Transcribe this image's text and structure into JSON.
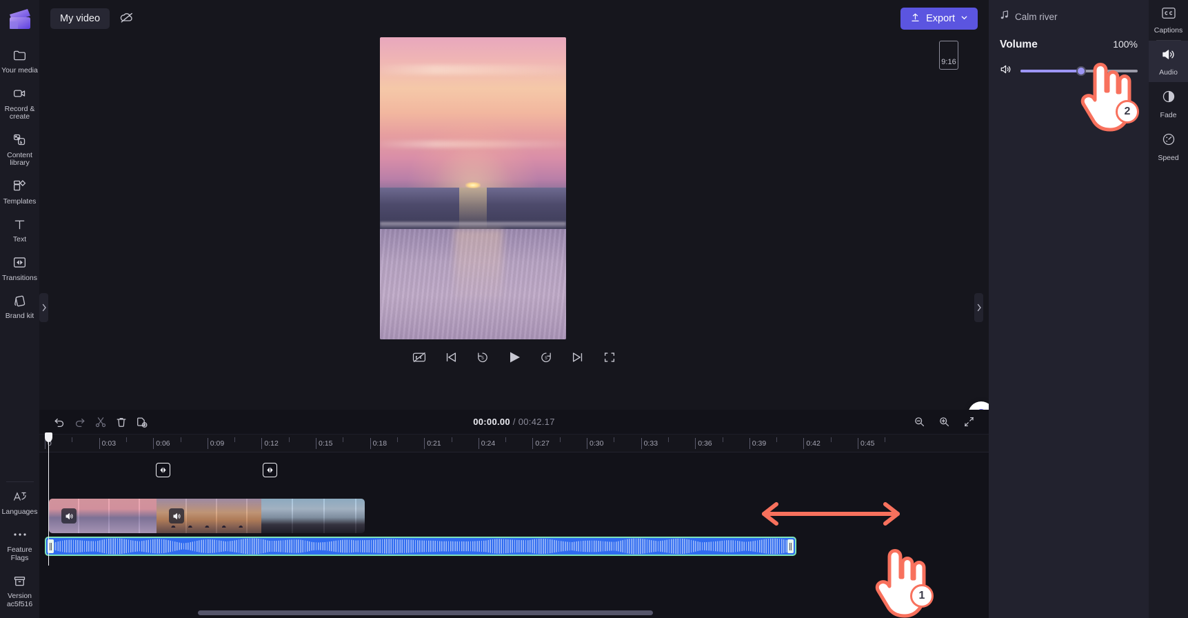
{
  "app": {
    "project_title": "My video",
    "export_label": "Export"
  },
  "left_rail": {
    "items": [
      {
        "label": "Your media",
        "icon": "folder-icon"
      },
      {
        "label": "Record & create",
        "icon": "camera-icon"
      },
      {
        "label": "Content library",
        "icon": "library-icon"
      },
      {
        "label": "Templates",
        "icon": "templates-icon"
      },
      {
        "label": "Text",
        "icon": "text-icon"
      },
      {
        "label": "Transitions",
        "icon": "transitions-icon"
      },
      {
        "label": "Brand kit",
        "icon": "brandkit-icon"
      }
    ],
    "bottom_items": [
      {
        "label": "Languages",
        "icon": "languages-icon"
      },
      {
        "label": "Feature Flags",
        "icon": "ellipsis-icon"
      },
      {
        "label": "Version ac5f516",
        "icon": "box-icon"
      }
    ]
  },
  "preview": {
    "aspect_ratio": "9:16",
    "help_label": "?",
    "controls": [
      {
        "name": "captions-off-button",
        "icon": "captions-off-icon"
      },
      {
        "name": "previous-frame-button",
        "icon": "skip-back-icon"
      },
      {
        "name": "back-5s-button",
        "icon": "rewind-5-icon"
      },
      {
        "name": "play-button",
        "icon": "play-icon"
      },
      {
        "name": "forward-5s-button",
        "icon": "forward-5-icon"
      },
      {
        "name": "next-frame-button",
        "icon": "skip-forward-icon"
      },
      {
        "name": "fullscreen-button",
        "icon": "fullscreen-icon"
      }
    ]
  },
  "timeline": {
    "tools": [
      {
        "name": "undo-button",
        "icon": "undo-icon"
      },
      {
        "name": "redo-button",
        "icon": "redo-icon"
      },
      {
        "name": "split-button",
        "icon": "scissors-icon"
      },
      {
        "name": "delete-button",
        "icon": "trash-icon"
      },
      {
        "name": "duplicate-button",
        "icon": "duplicate-icon"
      }
    ],
    "current_time": "00:00.00",
    "separator": "/",
    "total_time": "00:42.17",
    "zoom_tools": [
      {
        "name": "zoom-out-button",
        "icon": "zoom-out-icon"
      },
      {
        "name": "zoom-in-button",
        "icon": "zoom-in-icon"
      },
      {
        "name": "fit-timeline-button",
        "icon": "fit-icon"
      }
    ],
    "ruler_labels": [
      "0",
      "0:03",
      "0:06",
      "0:09",
      "0:12",
      "0:15",
      "0:18",
      "0:21",
      "0:24",
      "0:27",
      "0:30",
      "0:33",
      "0:36",
      "0:39",
      "0:42",
      "0:45"
    ],
    "video_clips": [
      {
        "name": "clip-sunset-beach"
      },
      {
        "name": "clip-people-silhouettes"
      },
      {
        "name": "clip-coastline"
      }
    ],
    "audio_clip": {
      "name": "Calm river"
    }
  },
  "right_panel": {
    "track_name": "Calm river",
    "volume_label": "Volume",
    "volume_value": "100%"
  },
  "right_rail": {
    "items": [
      {
        "label": "Captions",
        "icon": "cc-icon",
        "active": false
      },
      {
        "label": "Audio",
        "icon": "speaker-icon",
        "active": true
      },
      {
        "label": "Fade",
        "icon": "fade-icon",
        "active": false
      },
      {
        "label": "Speed",
        "icon": "speed-icon",
        "active": false
      }
    ]
  },
  "annotations": {
    "step_1": "1",
    "step_2": "2"
  },
  "colors": {
    "accent": "#5b55e0",
    "slider": "#9d96f5",
    "annotation": "#f8715d",
    "audio_clip": "#2f6bf0",
    "audio_border": "#7fe3b8"
  }
}
